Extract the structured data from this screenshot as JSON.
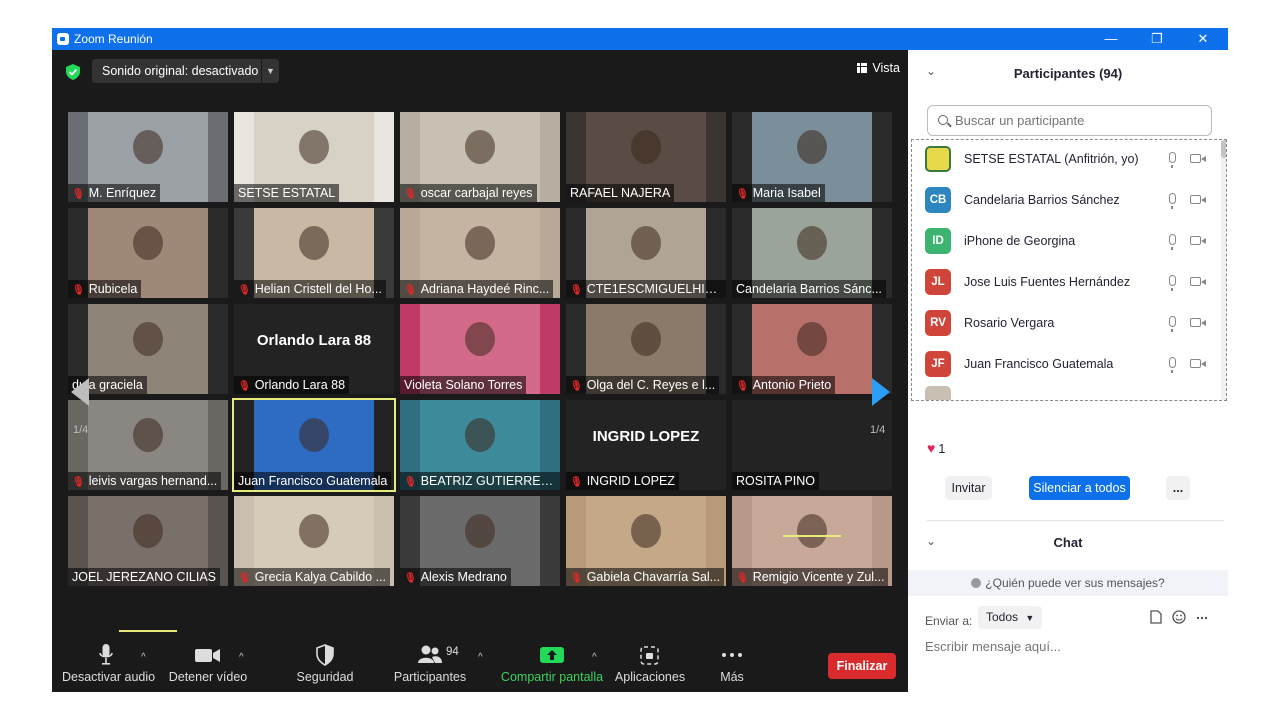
{
  "window": {
    "title": "Zoom Reunión",
    "controls": {
      "minimize": "—",
      "restore": "❐",
      "close": "✕"
    }
  },
  "top_bar": {
    "audio_label": "Sonido original: desactivado",
    "view_label": "Vista"
  },
  "gallery": {
    "page_indicator_left": "1/4",
    "page_indicator_right": "1/4",
    "tiles": [
      {
        "name": "M. Enríquez",
        "muted": true,
        "bg": "#6a6e72",
        "photo_bg": "#9aa0a4"
      },
      {
        "name": "SETSE ESTATAL",
        "muted": false,
        "bg": "#e9e6df",
        "photo_bg": "#d8d2c6"
      },
      {
        "name": "oscar carbajal reyes",
        "muted": true,
        "bg": "#b6aea0",
        "photo_bg": "#c8c0b2"
      },
      {
        "name": "RAFAEL NAJERA",
        "muted": false,
        "bg": "#3a3432",
        "photo_bg": "#5a4c44"
      },
      {
        "name": "Maria Isabel",
        "muted": true,
        "bg": "#2a2a2a",
        "photo_bg": "#7b8f9a"
      },
      {
        "name": "Rubicela",
        "muted": true,
        "bg": "#2a2a2a",
        "photo_bg": "#a08878"
      },
      {
        "name": "Helian Cristell del Ho...",
        "muted": true,
        "bg": "#3a3a3a",
        "photo_bg": "#c8b8a4"
      },
      {
        "name": "Adriana Haydeé Rinc...",
        "muted": true,
        "bg": "#b8a898",
        "photo_bg": "#c6b4a2"
      },
      {
        "name": "CTE1ESCMIGUELHIDA...",
        "muted": true,
        "bg": "#2a2a2a",
        "photo_bg": "#b0a496"
      },
      {
        "name": "Candelaria Barrios Sánc...",
        "muted": false,
        "bg": "#2a2a2a",
        "photo_bg": "#9aa49a"
      },
      {
        "name": "dula graciela",
        "muted": false,
        "bg": "#2a2a2a",
        "photo_bg": "#8e8478"
      },
      {
        "name": "Orlando Lara 88",
        "muted": true,
        "bg": "#232323",
        "photo_bg": "",
        "big": "Orlando Lara 88"
      },
      {
        "name": "Violeta Solano Torres",
        "muted": false,
        "bg": "#c03a68",
        "photo_bg": "#d46a8a"
      },
      {
        "name": "Olga del C. Reyes e l...",
        "muted": true,
        "bg": "#2a2a2a",
        "photo_bg": "#8a7a6a"
      },
      {
        "name": "Antonio Prieto",
        "muted": true,
        "bg": "#2a2a2a",
        "photo_bg": "#b8706a"
      },
      {
        "name": "leivis vargas hernand...",
        "muted": true,
        "bg": "#6a6662",
        "photo_bg": "#8a8682"
      },
      {
        "name": "Juan Francisco Guatemala",
        "muted": false,
        "bg": "#232323",
        "photo_bg": "#2e6cc4",
        "active": true
      },
      {
        "name": "BEATRIZ  GUTIERREZ ...",
        "muted": true,
        "bg": "#2f6f80",
        "photo_bg": "#3d8a9a"
      },
      {
        "name": "INGRID LOPEZ",
        "muted": true,
        "bg": "#232323",
        "photo_bg": "",
        "big": "INGRID LOPEZ"
      },
      {
        "name": "ROSITA PINO",
        "muted": false,
        "bg": "#232323",
        "photo_bg": ""
      },
      {
        "name": "JOEL JEREZANO CILIAS",
        "muted": false,
        "bg": "#5a5450",
        "photo_bg": "#7a706a"
      },
      {
        "name": "Grecia Kalya Cabildo ...",
        "muted": true,
        "bg": "#cabfae",
        "photo_bg": "#d6cab8"
      },
      {
        "name": "Alexis Medrano",
        "muted": true,
        "bg": "#3a3a3a",
        "photo_bg": "#6a6a6a"
      },
      {
        "name": "Gabiela Chavarría Sal...",
        "muted": true,
        "bg": "#b89a7a",
        "photo_bg": "#c4a888"
      },
      {
        "name": "Remigio Vicente y Zul...",
        "muted": true,
        "bg": "#b89888",
        "photo_bg": "#c8a898"
      }
    ]
  },
  "toolbar": {
    "mute_label": "Desactivar audio",
    "video_label": "Detener vídeo",
    "security_label": "Seguridad",
    "participants_label": "Participantes",
    "participants_count": "94",
    "share_label": "Compartir pantalla",
    "apps_label": "Aplicaciones",
    "more_label": "Más",
    "end_label": "Finalizar"
  },
  "panel": {
    "participants_title": "Participantes (94)",
    "search_placeholder": "Buscar un participante",
    "participants": [
      {
        "initials": "",
        "name": "SETSE ESTATAL (Anfitrión, yo)",
        "color": "#e8d94a"
      },
      {
        "initials": "CB",
        "name": "Candelaria Barrios Sánchez",
        "color": "#2e86c1"
      },
      {
        "initials": "ID",
        "name": "iPhone de Georgina",
        "color": "#3cb371"
      },
      {
        "initials": "JL",
        "name": "Jose Luis Fuentes Hernández",
        "color": "#d0453a"
      },
      {
        "initials": "RV",
        "name": "Rosario Vergara",
        "color": "#d0453a"
      },
      {
        "initials": "JF",
        "name": "Juan Francisco Guatemala",
        "color": "#d0453a"
      }
    ],
    "reaction_count": "1",
    "invite_label": "Invitar",
    "mute_all_label": "Silenciar a todos",
    "more_label": "...",
    "chat_title": "Chat",
    "who_can_see": "¿Quién puede ver sus mensajes?",
    "send_to_label": "Enviar a:",
    "send_to_value": "Todos",
    "chat_placeholder": "Escribir mensaje aquí..."
  },
  "colors": {
    "titlebar": "#0e71eb",
    "meeting_bg": "#1a1a1a",
    "end_button": "#d92b2b",
    "mute_all_button": "#0e71eb",
    "active_speaker": "#e7eb7e",
    "share_green": "#3ad35e"
  }
}
